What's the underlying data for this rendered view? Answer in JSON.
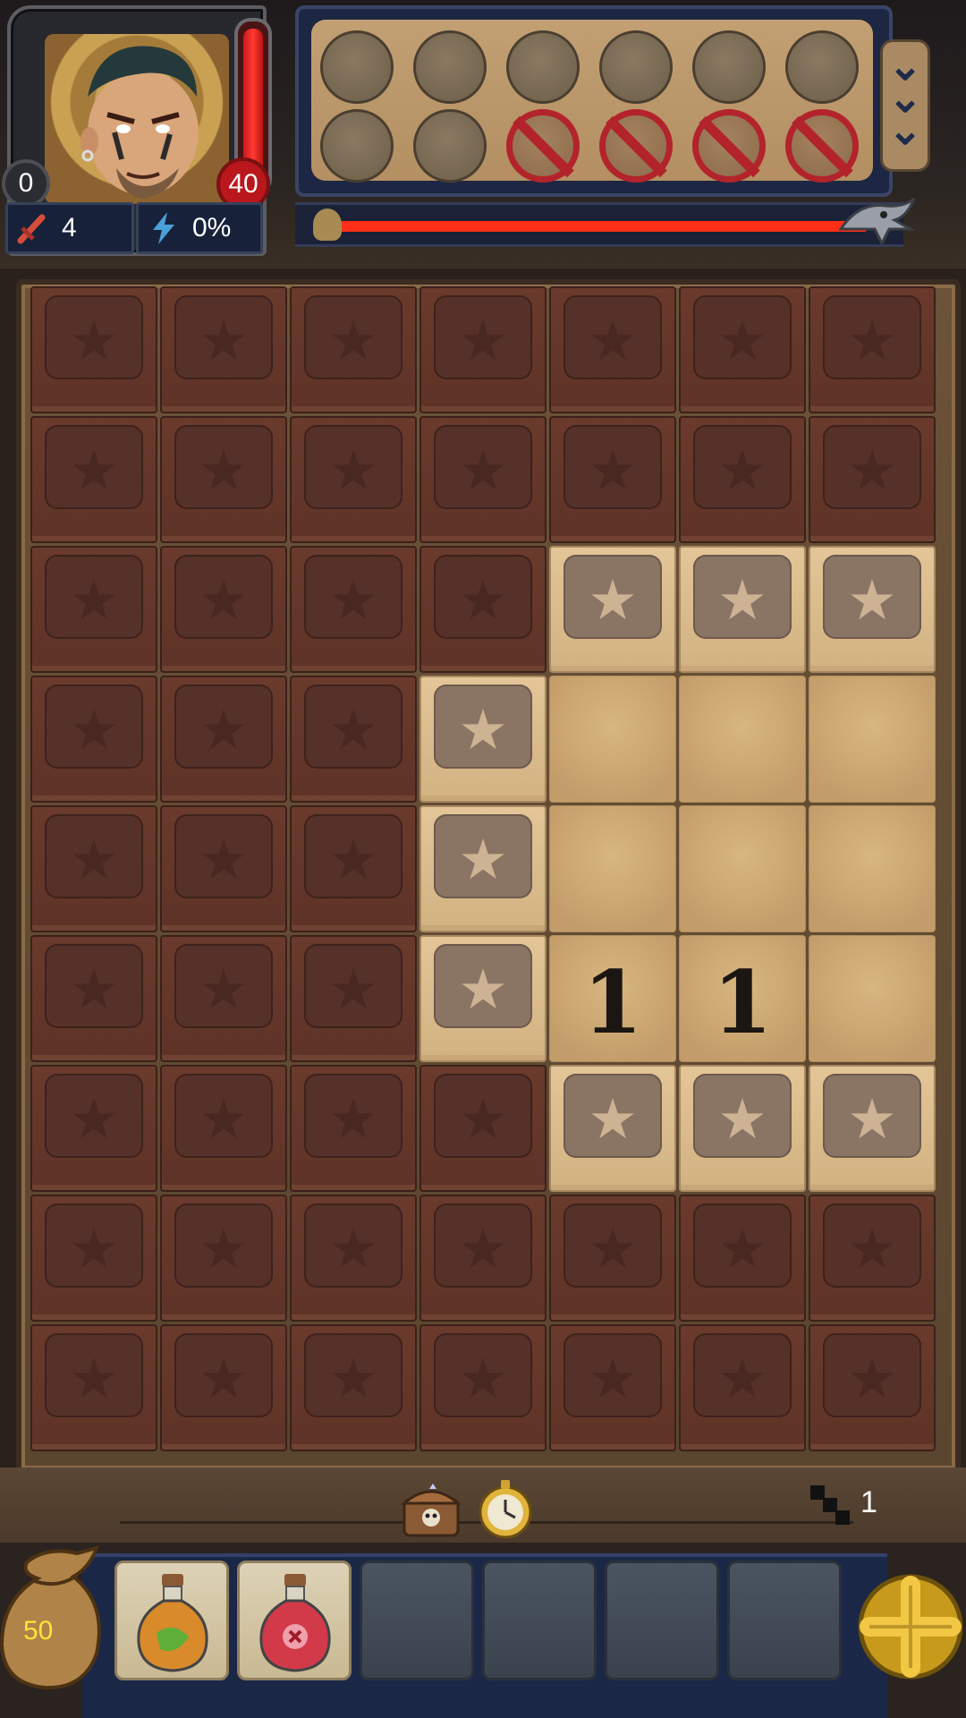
{
  "hero": {
    "shield": "0",
    "hp": "40",
    "attack": "4",
    "energy": "0%"
  },
  "inventory_slots": {
    "row1": [
      "empty",
      "empty",
      "empty",
      "empty",
      "empty",
      "empty"
    ],
    "row2": [
      "empty",
      "empty",
      "blocked",
      "blocked",
      "blocked",
      "blocked"
    ]
  },
  "board": {
    "columns": 7,
    "rows": 9,
    "tiles": [
      [
        "covered",
        "covered",
        "covered",
        "covered",
        "covered",
        "covered",
        "covered"
      ],
      [
        "covered",
        "covered",
        "covered",
        "covered",
        "covered",
        "covered",
        "covered"
      ],
      [
        "covered",
        "covered",
        "covered",
        "covered",
        "opened",
        "opened",
        "opened"
      ],
      [
        "covered",
        "covered",
        "covered",
        "opened",
        "empty",
        "empty",
        "empty"
      ],
      [
        "covered",
        "covered",
        "covered",
        "opened",
        "empty",
        "empty",
        "empty"
      ],
      [
        "covered",
        "covered",
        "covered",
        "opened",
        "1",
        "1",
        "empty"
      ],
      [
        "covered",
        "covered",
        "covered",
        "covered",
        "opened",
        "opened",
        "opened"
      ],
      [
        "covered",
        "covered",
        "covered",
        "covered",
        "covered",
        "covered",
        "covered"
      ],
      [
        "covered",
        "covered",
        "covered",
        "covered",
        "covered",
        "covered",
        "covered"
      ]
    ]
  },
  "footer": {
    "floor": "1",
    "gold": "50"
  },
  "hotbar": {
    "items": [
      "green-potion",
      "red-potion",
      "empty",
      "empty",
      "empty",
      "empty"
    ]
  },
  "colors": {
    "health": "#ff2f18",
    "gold": "#ffe43a",
    "blocked": "#b3232b"
  },
  "icons": {
    "attack": "sword-icon",
    "energy": "lightning-icon",
    "chest": "treasure-chest-icon",
    "timer": "stopwatch-icon",
    "floor": "stairs-icon",
    "boss": "boss-bird-icon",
    "add": "plus-icon"
  }
}
